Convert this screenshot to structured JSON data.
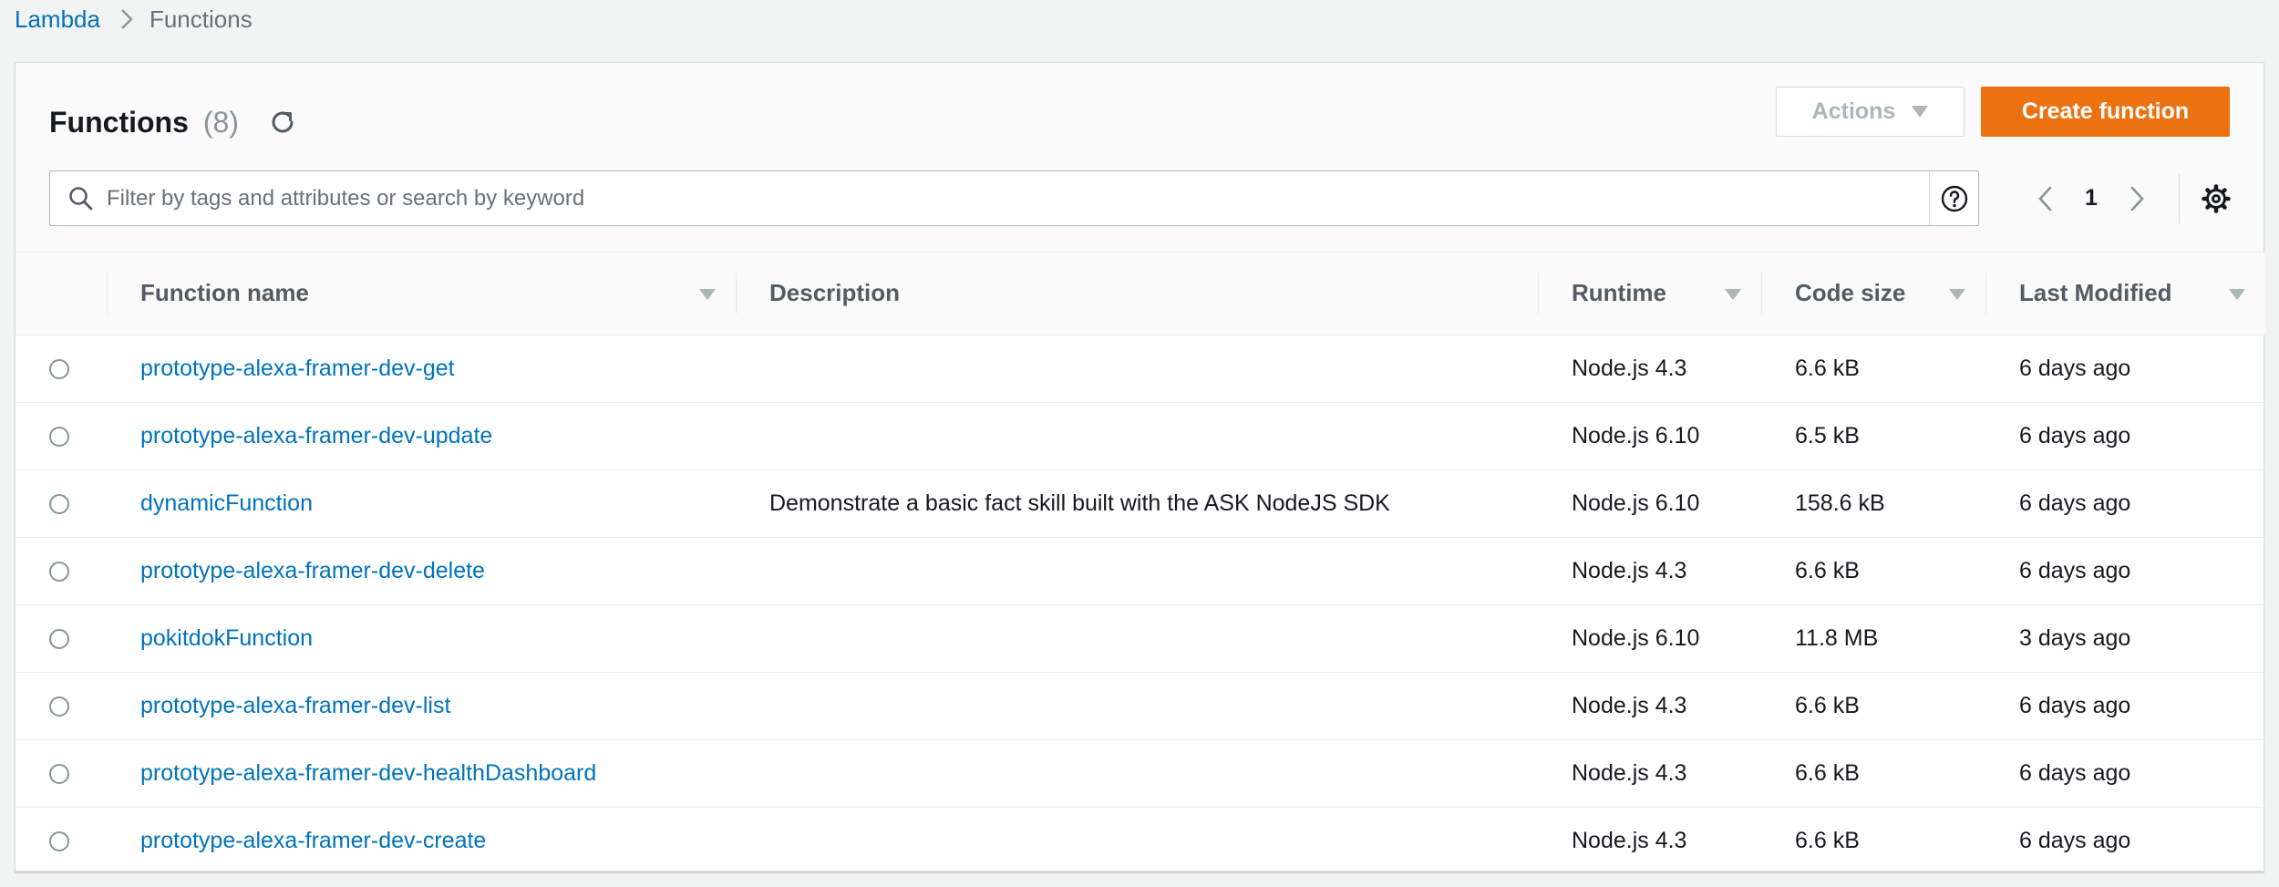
{
  "breadcrumb": {
    "root": "Lambda",
    "current": "Functions"
  },
  "header": {
    "title": "Functions",
    "count": "(8)"
  },
  "toolbar": {
    "actions_label": "Actions",
    "create_label": "Create function"
  },
  "search": {
    "placeholder": "Filter by tags and attributes or search by keyword",
    "value": ""
  },
  "pagination": {
    "current_page": "1"
  },
  "table": {
    "columns": [
      "Function name",
      "Description",
      "Runtime",
      "Code size",
      "Last Modified"
    ],
    "rows": [
      {
        "name": "prototype-alexa-framer-dev-get",
        "description": "",
        "runtime": "Node.js 4.3",
        "code_size": "6.6 kB",
        "last_modified": "6 days ago"
      },
      {
        "name": "prototype-alexa-framer-dev-update",
        "description": "",
        "runtime": "Node.js 6.10",
        "code_size": "6.5 kB",
        "last_modified": "6 days ago"
      },
      {
        "name": "dynamicFunction",
        "description": "Demonstrate a basic fact skill built with the ASK NodeJS SDK",
        "runtime": "Node.js 6.10",
        "code_size": "158.6 kB",
        "last_modified": "6 days ago"
      },
      {
        "name": "prototype-alexa-framer-dev-delete",
        "description": "",
        "runtime": "Node.js 4.3",
        "code_size": "6.6 kB",
        "last_modified": "6 days ago"
      },
      {
        "name": "pokitdokFunction",
        "description": "",
        "runtime": "Node.js 6.10",
        "code_size": "11.8 MB",
        "last_modified": "3 days ago"
      },
      {
        "name": "prototype-alexa-framer-dev-list",
        "description": "",
        "runtime": "Node.js 4.3",
        "code_size": "6.6 kB",
        "last_modified": "6 days ago"
      },
      {
        "name": "prototype-alexa-framer-dev-healthDashboard",
        "description": "",
        "runtime": "Node.js 4.3",
        "code_size": "6.6 kB",
        "last_modified": "6 days ago"
      },
      {
        "name": "prototype-alexa-framer-dev-create",
        "description": "",
        "runtime": "Node.js 4.3",
        "code_size": "6.6 kB",
        "last_modified": "6 days ago"
      }
    ]
  },
  "icons": {
    "breadcrumb_separator": "chevron-right-icon",
    "refresh": "refresh-icon",
    "actions_caret": "caret-down-icon",
    "search": "search-icon",
    "help": "help-circle-icon",
    "prev_page": "chevron-left-icon",
    "next_page": "chevron-right-icon",
    "settings": "gear-icon",
    "sort": "sort-caret-icon"
  },
  "colors": {
    "primary_button": "#ec7211",
    "link": "#0073bb",
    "background": "#f2f3f3",
    "muted_text": "#879596"
  }
}
